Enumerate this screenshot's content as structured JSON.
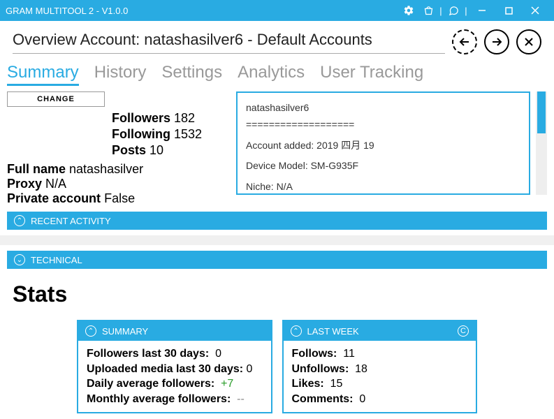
{
  "titlebar": {
    "title": "GRAM MULTITOOL 2 - V1.0.0"
  },
  "subhead": {
    "title": "Overview Account: natashasilver6 - Default Accounts"
  },
  "tabs": {
    "summary": "Summary",
    "history": "History",
    "settings": "Settings",
    "analytics": "Analytics",
    "usertracking": "User Tracking"
  },
  "changeBtn": "CHANGE",
  "stats": {
    "followersLabel": "Followers",
    "followersVal": "182",
    "followingLabel": "Following",
    "followingVal": "1532",
    "postsLabel": "Posts",
    "postsVal": "10"
  },
  "meta": {
    "fullnameLabel": "Full name",
    "fullnameVal": "natashasilver",
    "proxyLabel": "Proxy",
    "proxyVal": "N/A",
    "privateLabel": "Private account",
    "privateVal": "False"
  },
  "info": {
    "line1": "natashasilver6",
    "line2": "===================",
    "line3": "Account added: 2019 四月 19",
    "line4": "Device Model: SM-G935F",
    "line5": "Niche: N/A"
  },
  "acc": {
    "recent": "RECENT ACTIVITY",
    "technical": "TECHNICAL"
  },
  "statsHeader": "Stats",
  "card1": {
    "title": "SUMMARY",
    "r1l": "Followers last 30 days:",
    "r1v": "0",
    "r2l": "Uploaded media last 30 days:",
    "r2v": "0",
    "r3l": "Daily average followers:",
    "r3v": "+7",
    "r4l": "Monthly average followers:",
    "r4v": "--"
  },
  "card2": {
    "title": "LAST WEEK",
    "r1l": "Follows:",
    "r1v": "11",
    "r2l": "Unfollows:",
    "r2v": "18",
    "r3l": "Likes:",
    "r3v": "15",
    "r4l": "Comments:",
    "r4v": "0"
  }
}
